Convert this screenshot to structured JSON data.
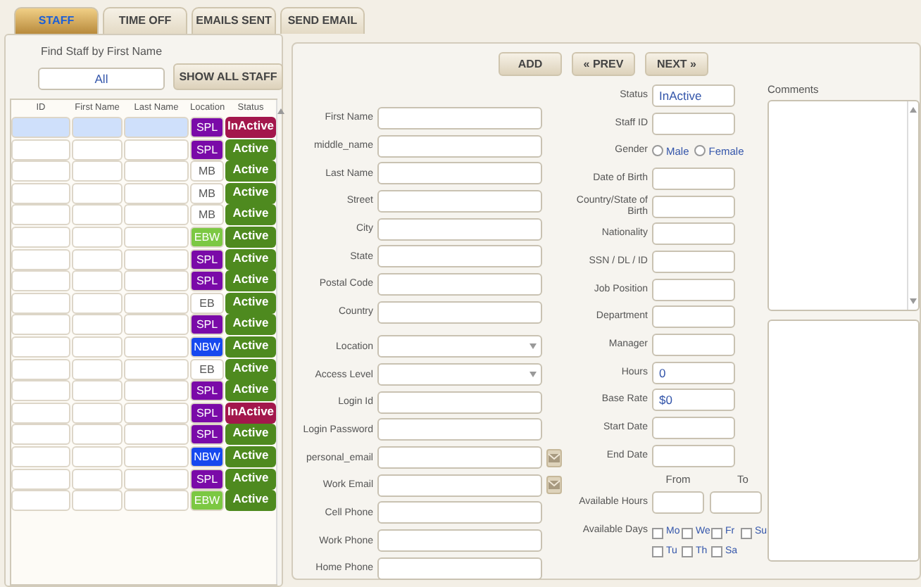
{
  "tabs": [
    {
      "label": "STAFF",
      "selected": true
    },
    {
      "label": "TIME OFF",
      "selected": false
    },
    {
      "label": "EMAILS SENT",
      "selected": false
    },
    {
      "label": "SEND EMAIL",
      "selected": false
    }
  ],
  "search": {
    "label": "Find Staff by First Name",
    "value": "All",
    "button": "SHOW ALL STAFF"
  },
  "staff_table": {
    "columns": [
      "ID",
      "First Name",
      "Last Name",
      "Location",
      "Status"
    ],
    "rows": [
      {
        "location": {
          "label": "SPL",
          "color": "#7a0aa8"
        },
        "status": {
          "label": "InActive",
          "color": "#a3174c"
        },
        "selected": true
      },
      {
        "location": {
          "label": "SPL",
          "color": "#7a0aa8"
        },
        "status": {
          "label": "Active",
          "color": "#4e8a1f"
        },
        "selected": false
      },
      {
        "location": {
          "label": "MB",
          "color": "#ffffff"
        },
        "status": {
          "label": "Active",
          "color": "#4e8a1f"
        },
        "selected": false
      },
      {
        "location": {
          "label": "MB",
          "color": "#ffffff"
        },
        "status": {
          "label": "Active",
          "color": "#4e8a1f"
        },
        "selected": false
      },
      {
        "location": {
          "label": "MB",
          "color": "#ffffff"
        },
        "status": {
          "label": "Active",
          "color": "#4e8a1f"
        },
        "selected": false
      },
      {
        "location": {
          "label": "EBW",
          "color": "#7cc843"
        },
        "status": {
          "label": "Active",
          "color": "#4e8a1f"
        },
        "selected": false
      },
      {
        "location": {
          "label": "SPL",
          "color": "#7a0aa8"
        },
        "status": {
          "label": "Active",
          "color": "#4e8a1f"
        },
        "selected": false
      },
      {
        "location": {
          "label": "SPL",
          "color": "#7a0aa8"
        },
        "status": {
          "label": "Active",
          "color": "#4e8a1f"
        },
        "selected": false
      },
      {
        "location": {
          "label": "EB",
          "color": "#ffffff"
        },
        "status": {
          "label": "Active",
          "color": "#4e8a1f"
        },
        "selected": false
      },
      {
        "location": {
          "label": "SPL",
          "color": "#7a0aa8"
        },
        "status": {
          "label": "Active",
          "color": "#4e8a1f"
        },
        "selected": false
      },
      {
        "location": {
          "label": "NBW",
          "color": "#1648ef"
        },
        "status": {
          "label": "Active",
          "color": "#4e8a1f"
        },
        "selected": false
      },
      {
        "location": {
          "label": "EB",
          "color": "#ffffff"
        },
        "status": {
          "label": "Active",
          "color": "#4e8a1f"
        },
        "selected": false
      },
      {
        "location": {
          "label": "SPL",
          "color": "#7a0aa8"
        },
        "status": {
          "label": "Active",
          "color": "#4e8a1f"
        },
        "selected": false
      },
      {
        "location": {
          "label": "SPL",
          "color": "#7a0aa8"
        },
        "status": {
          "label": "InActive",
          "color": "#a3174c"
        },
        "selected": false
      },
      {
        "location": {
          "label": "SPL",
          "color": "#7a0aa8"
        },
        "status": {
          "label": "Active",
          "color": "#4e8a1f"
        },
        "selected": false
      },
      {
        "location": {
          "label": "NBW",
          "color": "#1648ef"
        },
        "status": {
          "label": "Active",
          "color": "#4e8a1f"
        },
        "selected": false
      },
      {
        "location": {
          "label": "SPL",
          "color": "#7a0aa8"
        },
        "status": {
          "label": "Active",
          "color": "#4e8a1f"
        },
        "selected": false
      },
      {
        "location": {
          "label": "EBW",
          "color": "#7cc843"
        },
        "status": {
          "label": "Active",
          "color": "#4e8a1f"
        },
        "selected": false
      }
    ]
  },
  "nav_buttons": [
    "ADD",
    "« PREV",
    "NEXT »"
  ],
  "fields_left": [
    {
      "label": "First Name",
      "kind": "text"
    },
    {
      "label": "middle_name",
      "kind": "text"
    },
    {
      "label": "Last Name",
      "kind": "text"
    },
    {
      "label": "Street",
      "kind": "text"
    },
    {
      "label": "City",
      "kind": "text"
    },
    {
      "label": "State",
      "kind": "text"
    },
    {
      "label": "Postal Code",
      "kind": "text"
    },
    {
      "label": "Country",
      "kind": "text"
    },
    {
      "label": "Location",
      "kind": "select"
    },
    {
      "label": "Access Level",
      "kind": "select"
    },
    {
      "label": "Login Id",
      "kind": "text"
    },
    {
      "label": "Login Password",
      "kind": "text"
    },
    {
      "label": "personal_email",
      "kind": "email"
    },
    {
      "label": "Work Email",
      "kind": "email"
    },
    {
      "label": "Cell Phone",
      "kind": "text"
    },
    {
      "label": "Work Phone",
      "kind": "text"
    },
    {
      "label": "Home Phone",
      "kind": "text"
    }
  ],
  "fields_middle": [
    {
      "label": "Status",
      "kind": "text",
      "value": "InActive"
    },
    {
      "label": "Staff ID",
      "kind": "text"
    },
    {
      "label": "Gender",
      "kind": "radio",
      "options": [
        {
          "label": "Male",
          "selected": false
        },
        {
          "label": "Female",
          "selected": false
        }
      ]
    },
    {
      "label": "Date of Birth",
      "kind": "text"
    },
    {
      "label": "Country/State of Birth",
      "kind": "text"
    },
    {
      "label": "Nationality",
      "kind": "text"
    },
    {
      "label": "SSN / DL / ID",
      "kind": "text"
    },
    {
      "label": "Job Position",
      "kind": "text"
    },
    {
      "label": "Department",
      "kind": "text"
    },
    {
      "label": "Manager",
      "kind": "text"
    },
    {
      "label": "Hours",
      "kind": "text",
      "value": "0"
    },
    {
      "label": "Base Rate",
      "kind": "text",
      "value": "$0"
    },
    {
      "label": "Start Date",
      "kind": "text"
    },
    {
      "label": "End Date",
      "kind": "text"
    }
  ],
  "available_hours": {
    "label": "Available Hours",
    "from": "From",
    "to": "To"
  },
  "available_days": {
    "label": "Available Days",
    "days": [
      {
        "label": "Mo",
        "checked": false
      },
      {
        "label": "We",
        "checked": false
      },
      {
        "label": "Fr",
        "checked": false
      },
      {
        "label": "Su",
        "checked": false
      },
      {
        "label": "Tu",
        "checked": false
      },
      {
        "label": "Th",
        "checked": false
      },
      {
        "label": "Sa",
        "checked": false
      }
    ]
  },
  "comments": {
    "label": "Comments"
  }
}
